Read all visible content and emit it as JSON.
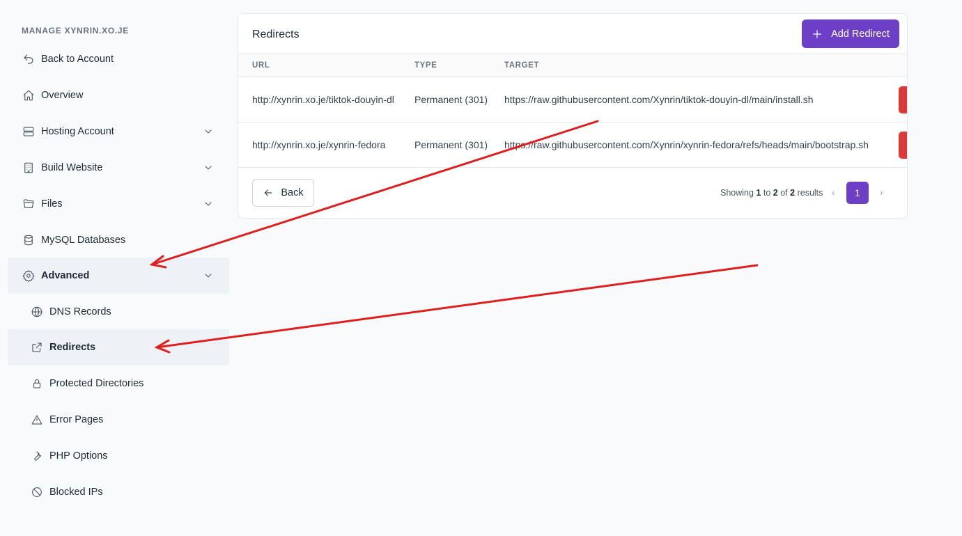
{
  "sidebar": {
    "heading": "MANAGE XYNRIN.XO.JE",
    "items": [
      {
        "label": "Back to Account",
        "icon": "back-arrow-icon"
      },
      {
        "label": "Overview",
        "icon": "home-icon"
      },
      {
        "label": "Hosting Account",
        "icon": "server-icon"
      },
      {
        "label": "Build Website",
        "icon": "building-icon"
      },
      {
        "label": "Files",
        "icon": "folder-icon"
      },
      {
        "label": "MySQL Databases",
        "icon": "database-icon"
      },
      {
        "label": "Advanced",
        "icon": "gear-icon"
      },
      {
        "label": "DNS Records",
        "icon": "globe-icon"
      },
      {
        "label": "Redirects",
        "icon": "external-link-icon"
      },
      {
        "label": "Protected Directories",
        "icon": "lock-icon"
      },
      {
        "label": "Error Pages",
        "icon": "warning-icon"
      },
      {
        "label": "PHP Options",
        "icon": "wrench-icon"
      },
      {
        "label": "Blocked IPs",
        "icon": "blocked-icon"
      }
    ]
  },
  "main": {
    "title": "Redirects",
    "add_button": "Add Redirect",
    "columns": [
      "URL",
      "TYPE",
      "TARGET"
    ],
    "rows": [
      {
        "url": "http://xynrin.xo.je/tiktok-douyin-dl",
        "type": "Permanent (301)",
        "target": "https://raw.githubusercontent.com/Xynrin/tiktok-douyin-dl/main/install.sh"
      },
      {
        "url": "http://xynrin.xo.je/xynrin-fedora",
        "type": "Permanent (301)",
        "target": "https://raw.githubusercontent.com/Xynrin/xynrin-fedora/refs/heads/main/bootstrap.sh"
      }
    ],
    "back_button": "Back",
    "pagination": {
      "showing": "Showing",
      "from": "1",
      "to_word": "to",
      "to": "2",
      "of_word": "of",
      "total": "2",
      "results": "results",
      "page": "1",
      "prev": "‹",
      "next": "›"
    }
  },
  "colors": {
    "accent": "#6d3fc6",
    "danger": "#dc3a3a",
    "annotation": "#e11d1d"
  }
}
